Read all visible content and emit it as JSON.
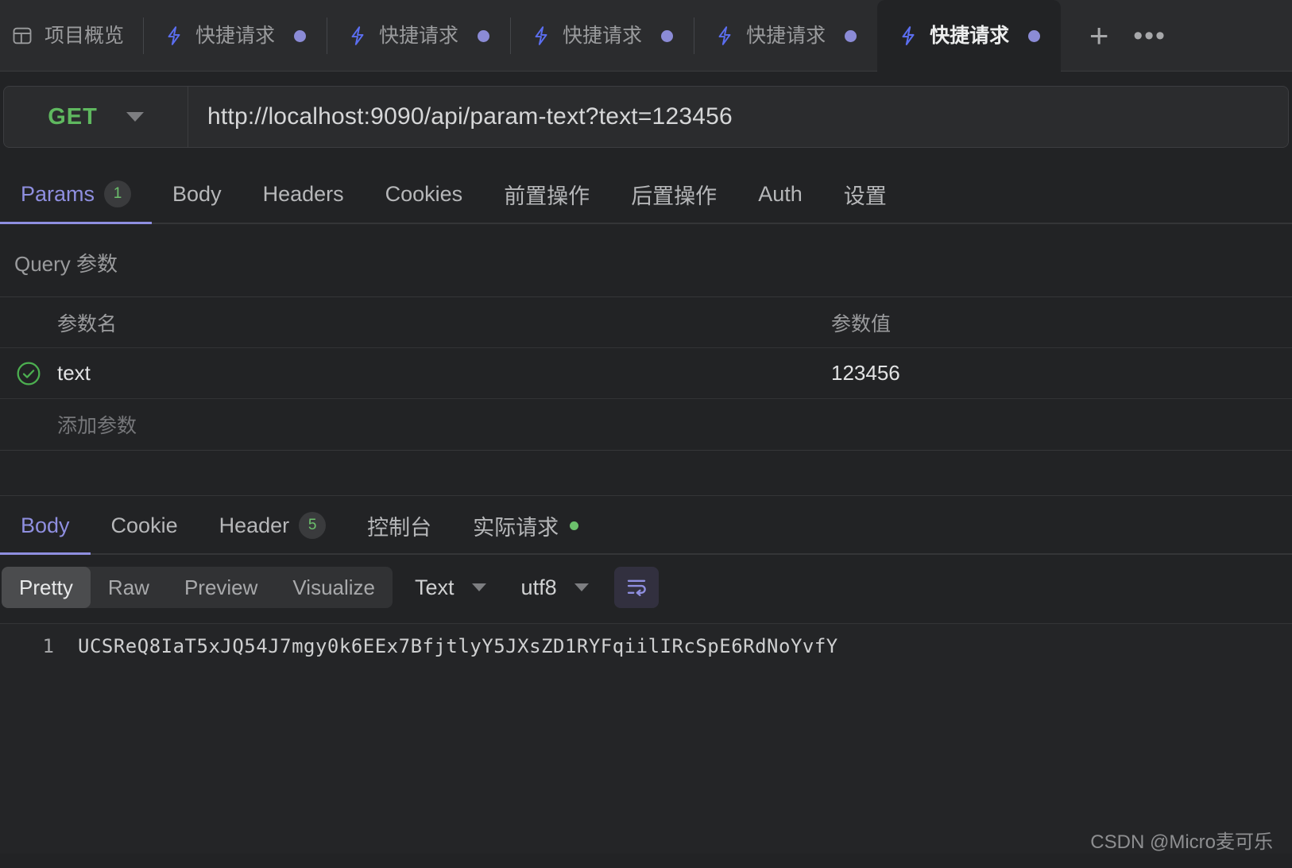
{
  "window": {
    "background": "#222325",
    "accent": "#8f8fe0",
    "success": "#5fb85f"
  },
  "tabbar": {
    "overview": {
      "label": "项目概览",
      "icon": "layout-icon"
    },
    "tabs": [
      {
        "label": "快捷请求",
        "icon": "bolt-icon",
        "dirty": true,
        "active": false
      },
      {
        "label": "快捷请求",
        "icon": "bolt-icon",
        "dirty": true,
        "active": false
      },
      {
        "label": "快捷请求",
        "icon": "bolt-icon",
        "dirty": true,
        "active": false
      },
      {
        "label": "快捷请求",
        "icon": "bolt-icon",
        "dirty": true,
        "active": false
      },
      {
        "label": "快捷请求",
        "icon": "bolt-icon",
        "dirty": true,
        "active": true
      }
    ],
    "add_label": "+",
    "more_label": "•••"
  },
  "urlbar": {
    "method": "GET",
    "method_icon": "chevron-down-icon",
    "url": "http://localhost:9090/api/param-text?text=123456"
  },
  "request_tabs": [
    {
      "label": "Params",
      "badge": "1",
      "active": true
    },
    {
      "label": "Body",
      "badge": null,
      "active": false
    },
    {
      "label": "Headers",
      "badge": null,
      "active": false
    },
    {
      "label": "Cookies",
      "badge": null,
      "active": false
    },
    {
      "label": "前置操作",
      "badge": null,
      "active": false
    },
    {
      "label": "后置操作",
      "badge": null,
      "active": false
    },
    {
      "label": "Auth",
      "badge": null,
      "active": false
    },
    {
      "label": "设置",
      "badge": null,
      "active": false
    }
  ],
  "params": {
    "section_title": "Query 参数",
    "columns": {
      "name": "参数名",
      "value": "参数值"
    },
    "rows": [
      {
        "enabled": true,
        "name": "text",
        "value": "123456"
      }
    ],
    "add_placeholder": "添加参数"
  },
  "response_tabs": [
    {
      "label": "Body",
      "badge": null,
      "dot": false,
      "active": true
    },
    {
      "label": "Cookie",
      "badge": null,
      "dot": false,
      "active": false
    },
    {
      "label": "Header",
      "badge": "5",
      "dot": false,
      "active": false
    },
    {
      "label": "控制台",
      "badge": null,
      "dot": false,
      "active": false
    },
    {
      "label": "实际请求",
      "badge": null,
      "dot": true,
      "active": false
    }
  ],
  "viewbar": {
    "modes": [
      {
        "label": "Pretty",
        "active": true
      },
      {
        "label": "Raw",
        "active": false
      },
      {
        "label": "Preview",
        "active": false
      },
      {
        "label": "Visualize",
        "active": false
      }
    ],
    "format": "Text",
    "charset": "utf8",
    "wrap_icon": "word-wrap-icon"
  },
  "body": {
    "lines": [
      {
        "number": "1",
        "text": "UCSReQ8IaT5xJQ54J7mgy0k6EEx7BfjtlyY5JXsZD1RYFqiilIRcSpE6RdNoYvfY"
      }
    ]
  },
  "watermark": "CSDN @Micro麦可乐"
}
